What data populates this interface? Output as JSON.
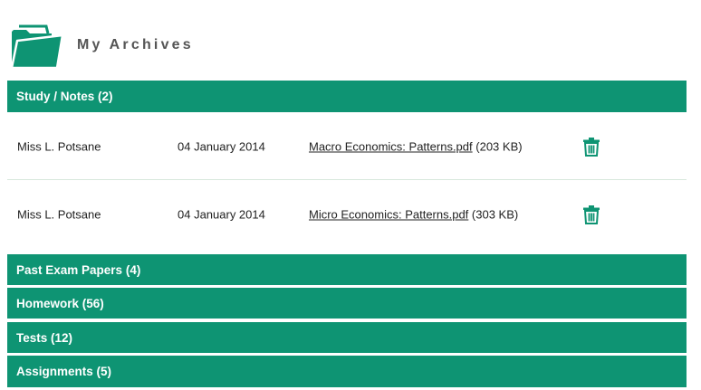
{
  "page": {
    "title": "My Archives",
    "accent_color": "#0e9473",
    "icon": "folder-icon"
  },
  "sections": [
    {
      "label": "Study / Notes (2)",
      "expanded": true
    },
    {
      "label": "Past Exam Papers (4)",
      "expanded": false
    },
    {
      "label": "Homework (56)",
      "expanded": false
    },
    {
      "label": "Tests (12)",
      "expanded": false
    },
    {
      "label": "Assignments (5)",
      "expanded": false
    }
  ],
  "study_notes_items": [
    {
      "teacher": "Miss L. Potsane",
      "date": "04 January 2014",
      "file_name": "Macro Economics: Patterns.pdf",
      "file_size": "(203 KB)",
      "action_icon": "trash-icon"
    },
    {
      "teacher": "Miss L. Potsane",
      "date": "04 January 2014",
      "file_name": "Micro Economics: Patterns.pdf",
      "file_size": "(303 KB)",
      "action_icon": "trash-icon"
    }
  ]
}
